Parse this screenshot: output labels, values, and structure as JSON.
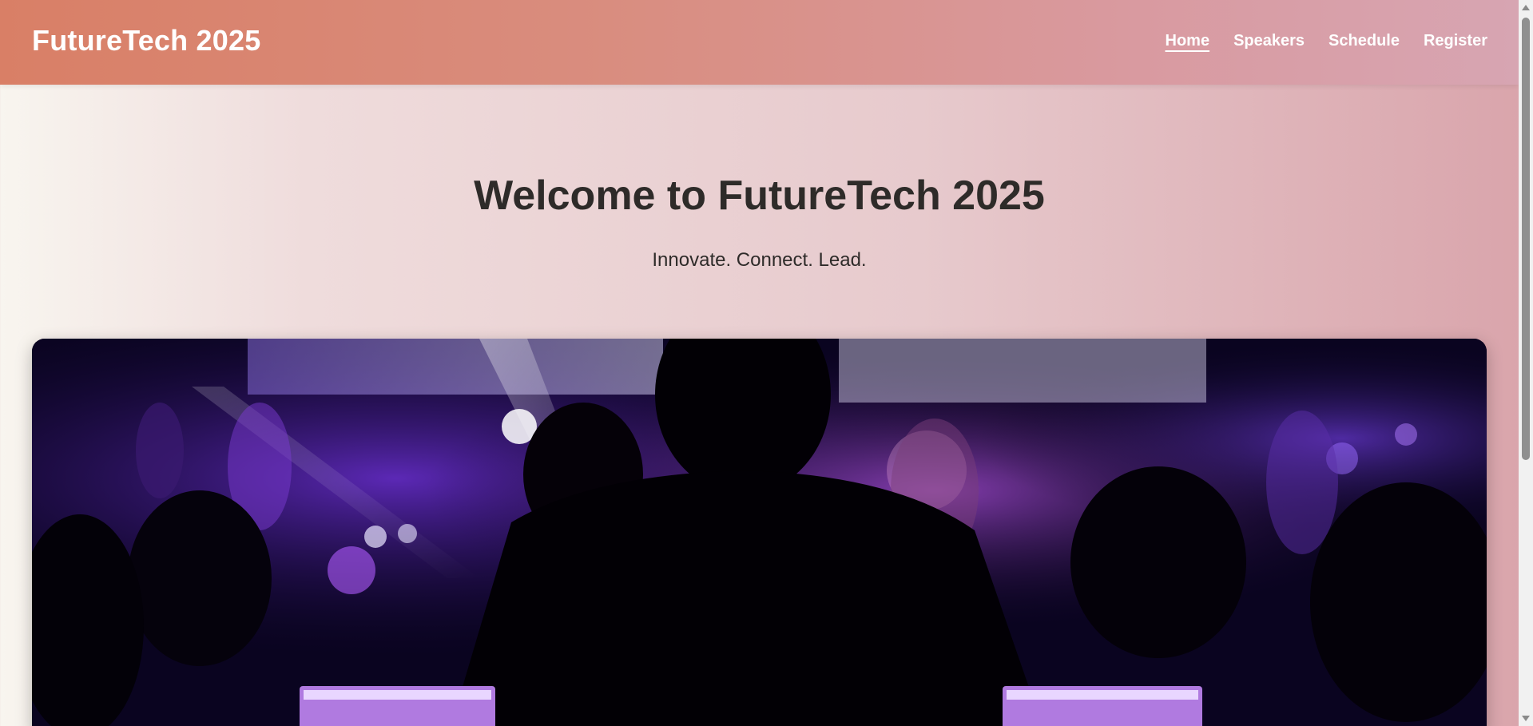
{
  "header": {
    "logo": "FutureTech 2025",
    "nav": [
      {
        "label": "Home",
        "active": true
      },
      {
        "label": "Speakers",
        "active": false
      },
      {
        "label": "Schedule",
        "active": false
      },
      {
        "label": "Register",
        "active": false
      }
    ]
  },
  "hero": {
    "title": "Welcome to FutureTech 2025",
    "subtitle": "Innovate. Connect. Lead.",
    "image_subject": "concert-crowd-photo"
  },
  "colors": {
    "header_start": "#d97f66",
    "header_end": "#d7a5b2",
    "text_dark": "#2e2b29",
    "accent_purple": "#8a3cff"
  }
}
